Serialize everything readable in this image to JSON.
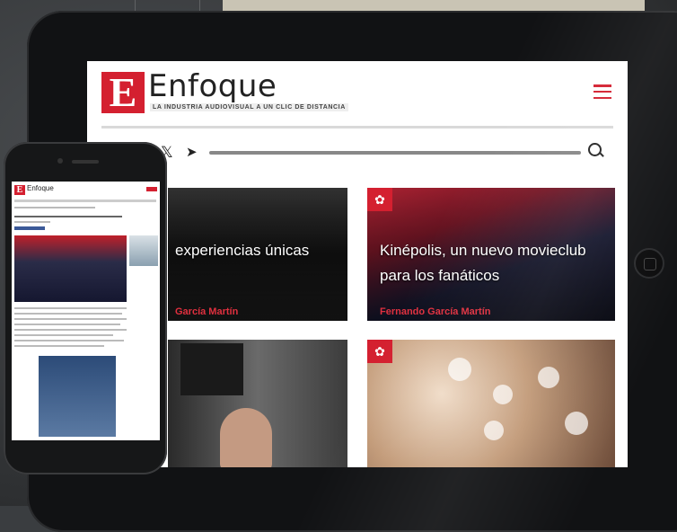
{
  "tablet": {
    "brand": {
      "logo_letter": "E",
      "name": "Enfoque",
      "tagline": "LA INDUSTRIA AUDIOVISUAL A UN CLIC DE DISTANCIA"
    },
    "social_icons": [
      "x-icon",
      "telegram-icon"
    ],
    "articles": [
      {
        "title": "experiencias únicas",
        "author": "García Martín"
      },
      {
        "title_line1": "Kinépolis, un nuevo movieclub",
        "title_line2": "para los fanáticos",
        "author": "Fernando García Martín"
      },
      {
        "title": "",
        "author": ""
      },
      {
        "title": "",
        "author": ""
      }
    ]
  },
  "phone": {
    "brand": {
      "logo_letter": "E",
      "name": "Enfoque"
    }
  },
  "colors": {
    "accent": "#d42030",
    "author": "#e0303f"
  }
}
